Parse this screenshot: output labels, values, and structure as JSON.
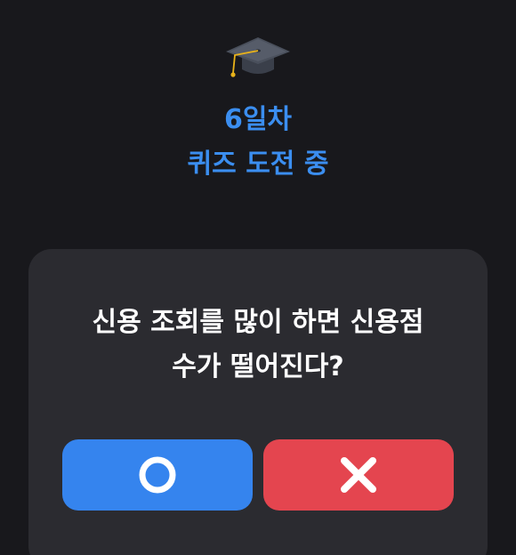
{
  "header": {
    "icon": "graduation-cap-icon",
    "day_label": "6일차",
    "status_label": "퀴즈 도전 중"
  },
  "quiz": {
    "question_line1": "신용 조회를 많이 하면 신용점",
    "question_line2": "수가 떨어진다?",
    "answers": [
      {
        "icon": "circle-o-icon",
        "color": "#3584ee"
      },
      {
        "icon": "x-mark-icon",
        "color": "#e4454f"
      }
    ]
  },
  "colors": {
    "background": "#18181c",
    "card": "#2b2b30",
    "accent_text": "#3b8ef0"
  }
}
